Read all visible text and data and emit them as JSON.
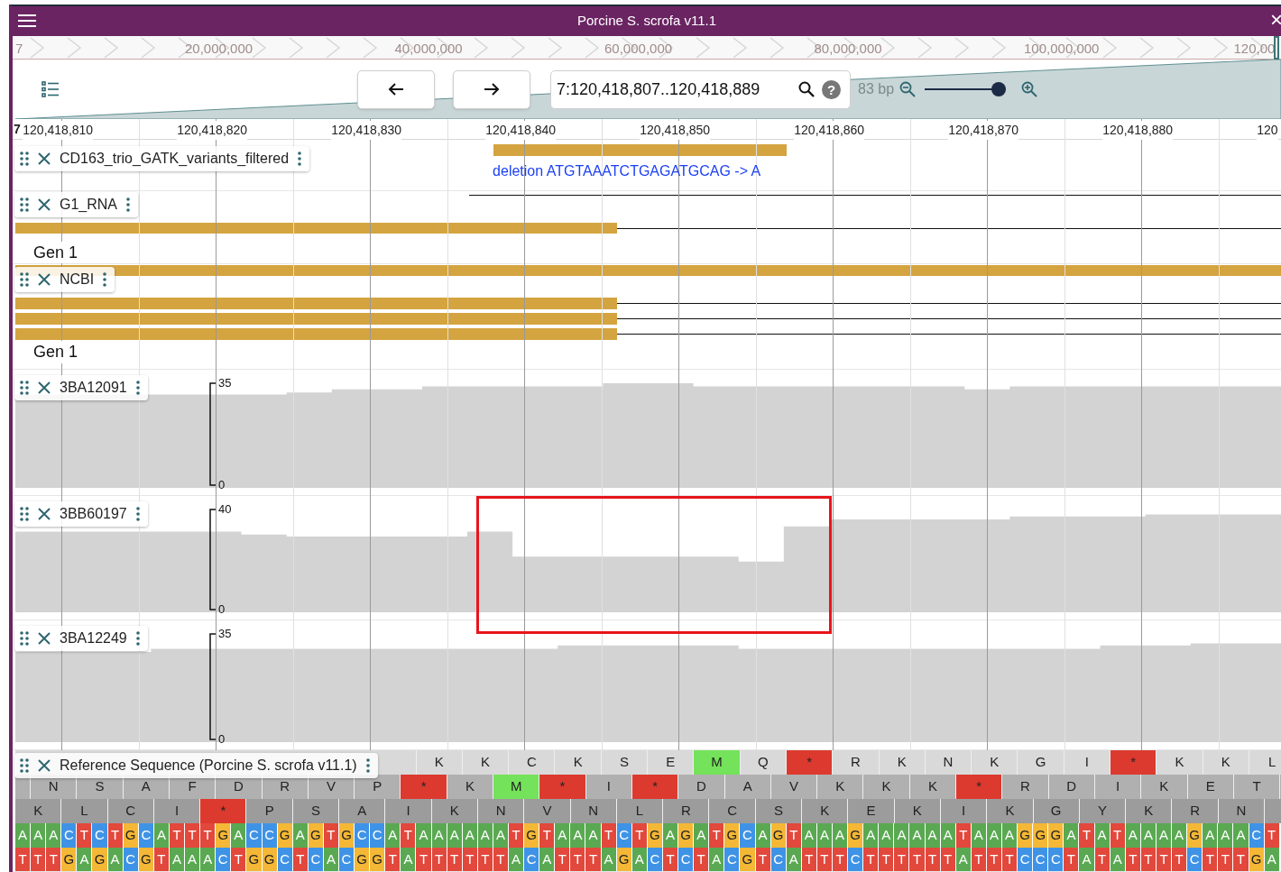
{
  "window": {
    "title": "Porcine S. scrofa v11.1",
    "close": "×"
  },
  "overview": {
    "labels": [
      "7",
      "20,000,000",
      "40,000,000",
      "60,000,000",
      "80,000,000",
      "100,000,000",
      "120,00"
    ]
  },
  "toolbar": {
    "location": "7:120,418,807..120,418,889",
    "help": "?",
    "span": "83 bp",
    "zoom": {
      "level": 0.95
    }
  },
  "ruler": {
    "chromosome": "7",
    "labels": [
      "120,418,810",
      "120,418,820",
      "120,418,830",
      "120,418,840",
      "120,418,850",
      "120,418,860",
      "120,418,870",
      "120,418,880",
      "120"
    ]
  },
  "tracks": [
    {
      "kind": "variants",
      "name": "CD163_trio_GATK_variants_filtered",
      "feature_label": "deletion ATGTAAATCTGAGATGCAG -> A"
    },
    {
      "kind": "genes",
      "name": "G1_RNA",
      "gene_label": "Gen 1"
    },
    {
      "kind": "genes",
      "name": "NCBI",
      "gene_label": "Gen 1"
    },
    {
      "kind": "coverage",
      "name": "3BA12091",
      "scale_max": "35",
      "scale_min": "0"
    },
    {
      "kind": "coverage",
      "name": "3BB60197",
      "scale_max": "40",
      "scale_min": "0"
    },
    {
      "kind": "coverage",
      "name": "3BA12249",
      "scale_max": "35",
      "scale_min": "0"
    },
    {
      "kind": "sequence",
      "name": "Reference Sequence (Porcine S. scrofa v11.1)",
      "frames": [
        [
          {
            "aa": "K",
            "kind": "codon"
          },
          {
            "aa": "K",
            "kind": "codon"
          },
          {
            "aa": "C",
            "kind": "codon"
          },
          {
            "aa": "K",
            "kind": "codon"
          },
          {
            "aa": "S",
            "kind": "codon"
          },
          {
            "aa": "E",
            "kind": "codon"
          },
          {
            "aa": "M",
            "kind": "start"
          },
          {
            "aa": "Q",
            "kind": "codon"
          },
          {
            "aa": "*",
            "kind": "stop"
          },
          {
            "aa": "R",
            "kind": "codon"
          },
          {
            "aa": "K",
            "kind": "codon"
          },
          {
            "aa": "N",
            "kind": "codon"
          },
          {
            "aa": "K",
            "kind": "codon"
          },
          {
            "aa": "G",
            "kind": "codon"
          },
          {
            "aa": "I",
            "kind": "codon"
          },
          {
            "aa": "*",
            "kind": "stop"
          },
          {
            "aa": "K",
            "kind": "codon"
          },
          {
            "aa": "K",
            "kind": "codon"
          },
          {
            "aa": "L",
            "kind": "codon"
          }
        ],
        [
          {
            "aa": "N",
            "kind": "codon"
          },
          {
            "aa": "S",
            "kind": "codon"
          },
          {
            "aa": "A",
            "kind": "codon"
          },
          {
            "aa": "F",
            "kind": "codon"
          },
          {
            "aa": "D",
            "kind": "codon"
          },
          {
            "aa": "R",
            "kind": "codon"
          },
          {
            "aa": "V",
            "kind": "codon"
          },
          {
            "aa": "P",
            "kind": "codon"
          },
          {
            "aa": "*",
            "kind": "stop"
          },
          {
            "aa": "K",
            "kind": "codon"
          },
          {
            "aa": "M",
            "kind": "start"
          },
          {
            "aa": "*",
            "kind": "stop"
          },
          {
            "aa": "I",
            "kind": "codon"
          },
          {
            "aa": "*",
            "kind": "stop"
          },
          {
            "aa": "D",
            "kind": "codon"
          },
          {
            "aa": "A",
            "kind": "codon"
          },
          {
            "aa": "V",
            "kind": "codon"
          },
          {
            "aa": "K",
            "kind": "codon"
          },
          {
            "aa": "K",
            "kind": "codon"
          },
          {
            "aa": "K",
            "kind": "codon"
          },
          {
            "aa": "*",
            "kind": "stop"
          },
          {
            "aa": "R",
            "kind": "codon"
          },
          {
            "aa": "D",
            "kind": "codon"
          },
          {
            "aa": "I",
            "kind": "codon"
          },
          {
            "aa": "K",
            "kind": "codon"
          },
          {
            "aa": "E",
            "kind": "codon"
          },
          {
            "aa": "T",
            "kind": "codon"
          }
        ],
        [
          {
            "aa": "K",
            "kind": "codon"
          },
          {
            "aa": "L",
            "kind": "codon"
          },
          {
            "aa": "C",
            "kind": "codon"
          },
          {
            "aa": "I",
            "kind": "codon"
          },
          {
            "aa": "*",
            "kind": "stop"
          },
          {
            "aa": "P",
            "kind": "codon"
          },
          {
            "aa": "S",
            "kind": "codon"
          },
          {
            "aa": "A",
            "kind": "codon"
          },
          {
            "aa": "I",
            "kind": "codon"
          },
          {
            "aa": "K",
            "kind": "codon"
          },
          {
            "aa": "N",
            "kind": "codon"
          },
          {
            "aa": "V",
            "kind": "codon"
          },
          {
            "aa": "N",
            "kind": "codon"
          },
          {
            "aa": "L",
            "kind": "codon"
          },
          {
            "aa": "R",
            "kind": "codon"
          },
          {
            "aa": "C",
            "kind": "codon"
          },
          {
            "aa": "S",
            "kind": "codon"
          },
          {
            "aa": "K",
            "kind": "codon"
          },
          {
            "aa": "E",
            "kind": "codon"
          },
          {
            "aa": "K",
            "kind": "codon"
          },
          {
            "aa": "I",
            "kind": "codon"
          },
          {
            "aa": "K",
            "kind": "codon"
          },
          {
            "aa": "G",
            "kind": "codon"
          },
          {
            "aa": "Y",
            "kind": "codon"
          },
          {
            "aa": "K",
            "kind": "codon"
          },
          {
            "aa": "R",
            "kind": "codon"
          },
          {
            "aa": "N",
            "kind": "codon"
          }
        ]
      ],
      "forward": [
        "A",
        "A",
        "A",
        "C",
        "T",
        "C",
        "T",
        "G",
        "C",
        "A",
        "T",
        "T",
        "T",
        "G",
        "A",
        "C",
        "C",
        "G",
        "A",
        "G",
        "T",
        "G",
        "C",
        "C",
        "A",
        "T",
        "A",
        "A",
        "A",
        "A",
        "A",
        "A",
        "T",
        "G",
        "T",
        "A",
        "A",
        "A",
        "T",
        "C",
        "T",
        "G",
        "A",
        "G",
        "A",
        "T",
        "G",
        "C",
        "A",
        "G",
        "T",
        "A",
        "A",
        "A",
        "G",
        "A",
        "A",
        "A",
        "A",
        "A",
        "A",
        "T",
        "A",
        "A",
        "A",
        "G",
        "G",
        "G",
        "A",
        "T",
        "A",
        "T",
        "A",
        "A",
        "A",
        "A",
        "G",
        "A",
        "A",
        "A",
        "C",
        "T"
      ],
      "reverse": [
        "T",
        "T",
        "T",
        "G",
        "A",
        "G",
        "A",
        "C",
        "G",
        "T",
        "A",
        "A",
        "A",
        "C",
        "T",
        "G",
        "G",
        "C",
        "T",
        "C",
        "A",
        "C",
        "G",
        "G",
        "T",
        "A",
        "T",
        "T",
        "T",
        "T",
        "T",
        "T",
        "A",
        "C",
        "A",
        "T",
        "T",
        "T",
        "A",
        "G",
        "A",
        "C",
        "T",
        "C",
        "T",
        "A",
        "C",
        "G",
        "T",
        "C",
        "A",
        "T",
        "T",
        "T",
        "C",
        "T",
        "T",
        "T",
        "T",
        "T",
        "T",
        "A",
        "T",
        "T",
        "T",
        "C",
        "C",
        "C",
        "T",
        "A",
        "T",
        "A",
        "T",
        "T",
        "T",
        "T",
        "C",
        "T",
        "T",
        "T",
        "G",
        "A"
      ]
    }
  ]
}
